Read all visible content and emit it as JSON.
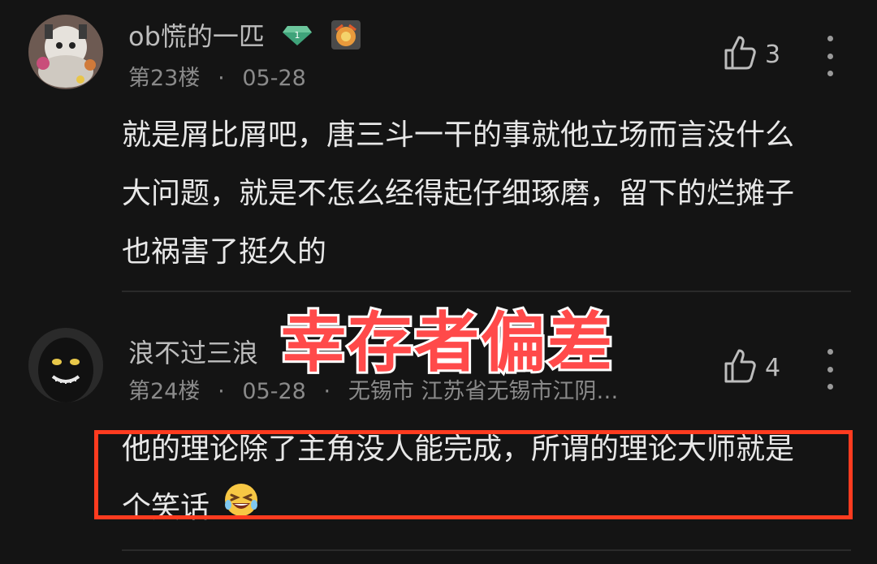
{
  "comments": [
    {
      "username": "ob慌的一匹",
      "floor": "第23楼",
      "date": "05-28",
      "location": "",
      "likes": "3",
      "content_lines": [
        "就是屑比屑吧，唐三斗一干的事就他立场而言没什么",
        "大问题，就是不怎么经得起仔细琢磨，留下的烂摊子",
        "也祸害了挺久的"
      ],
      "badges": [
        "level-badge-icon",
        "emoji-badge-icon"
      ],
      "level": "1"
    },
    {
      "username": "浪不过三浪",
      "floor": "第24楼",
      "date": "05-28",
      "location": "无锡市 江苏省无锡市江阴…",
      "likes": "4",
      "content_lines": [
        "他的理论除了主角没人能完成，所谓的理论大师就是",
        "个笑话"
      ],
      "badges": [],
      "level": ""
    }
  ],
  "overlay": {
    "title": "幸存者偏差"
  },
  "icons": {
    "like": "thumbs-up-icon",
    "more": "more-vertical-icon",
    "emoji": "grinning-squint-emoji-icon"
  },
  "colors": {
    "background": "#141414",
    "overlay_text": "#ff4a4a",
    "highlight_border": "#ff3b1f",
    "badge_green": "#3fa37a"
  },
  "separator": "·"
}
